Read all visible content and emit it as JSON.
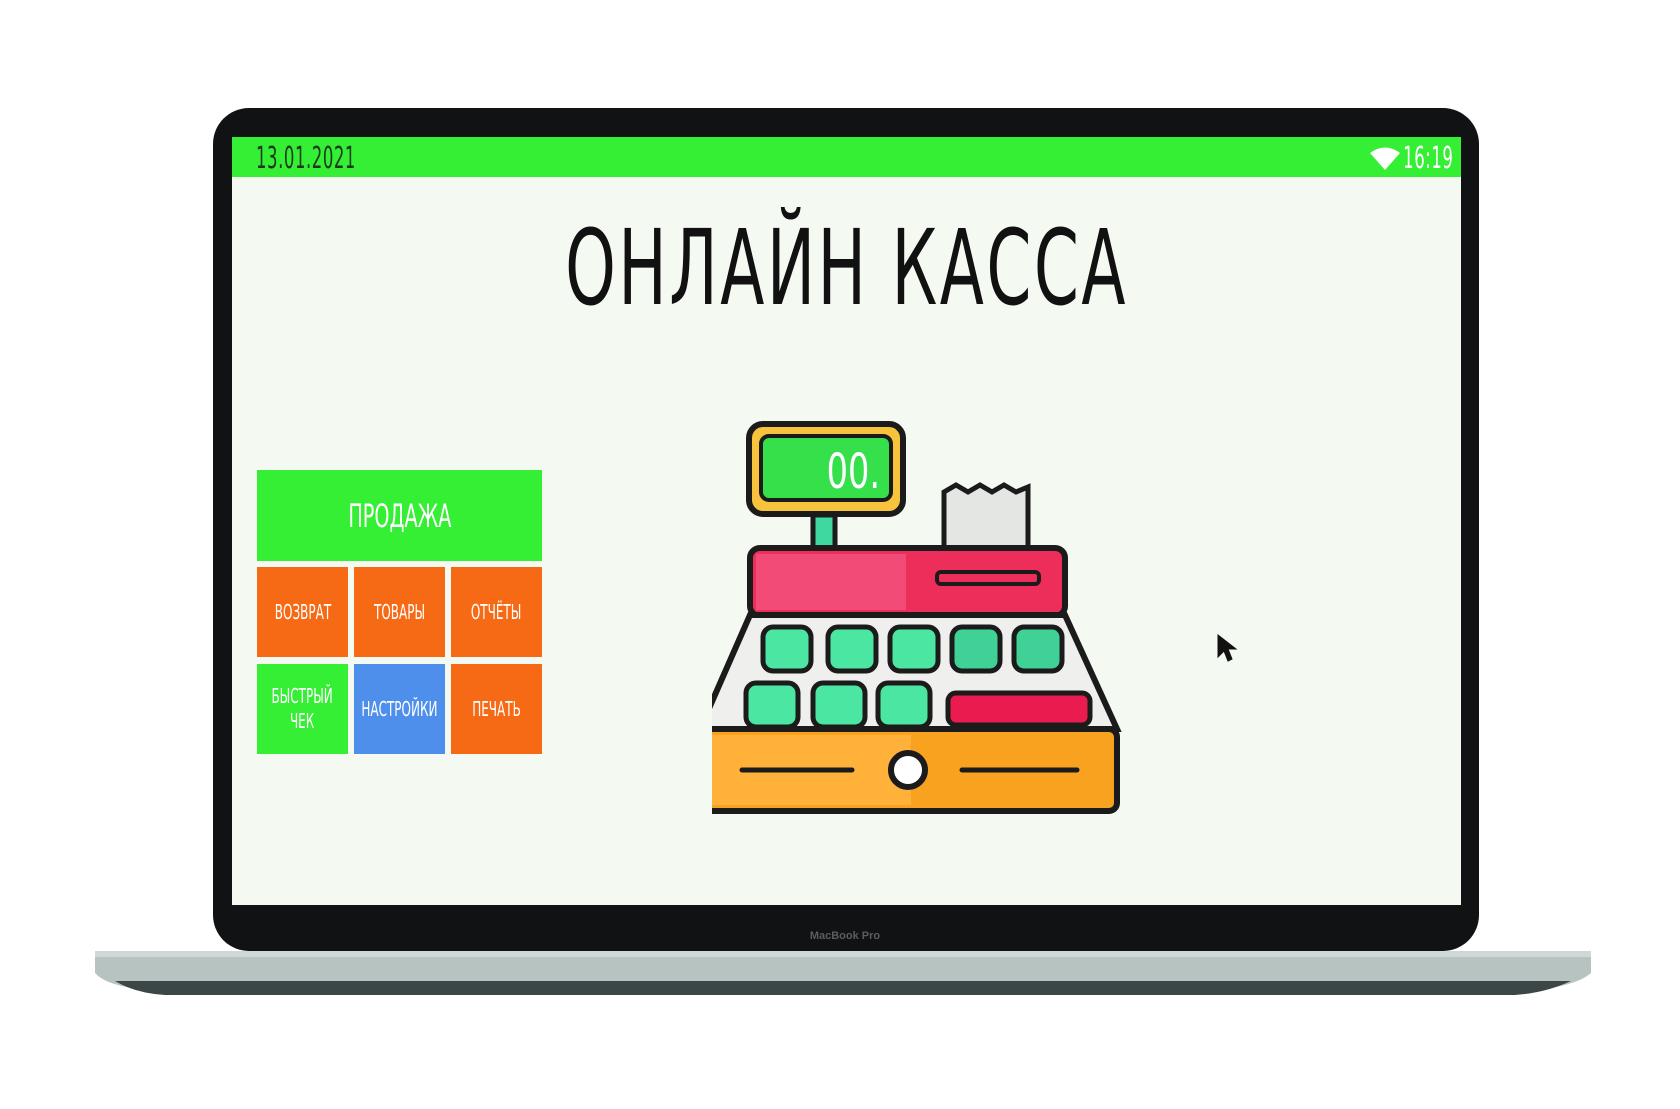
{
  "status_bar": {
    "date": "13.01.2021",
    "time": "16:19",
    "wifi_icon": "wifi-icon",
    "color": "#35ef34"
  },
  "title": "ОНЛАЙН КАССА",
  "menu": {
    "sale": "ПРОДАЖА",
    "return": "ВОЗВРАТ",
    "products": "ТОВАРЫ",
    "reports": "ОТЧЁТЫ",
    "quick_receipt": "БЫСТРЫЙ\nЧЕК",
    "settings": "НАСТРОЙКИ",
    "print": "ПЕЧАТЬ"
  },
  "register": {
    "display": "00.",
    "icon": "cash-register-icon"
  },
  "device_label": "MacBook Pro",
  "colors": {
    "green": "#35ef34",
    "orange": "#f66a16",
    "blue": "#4f8fec"
  }
}
